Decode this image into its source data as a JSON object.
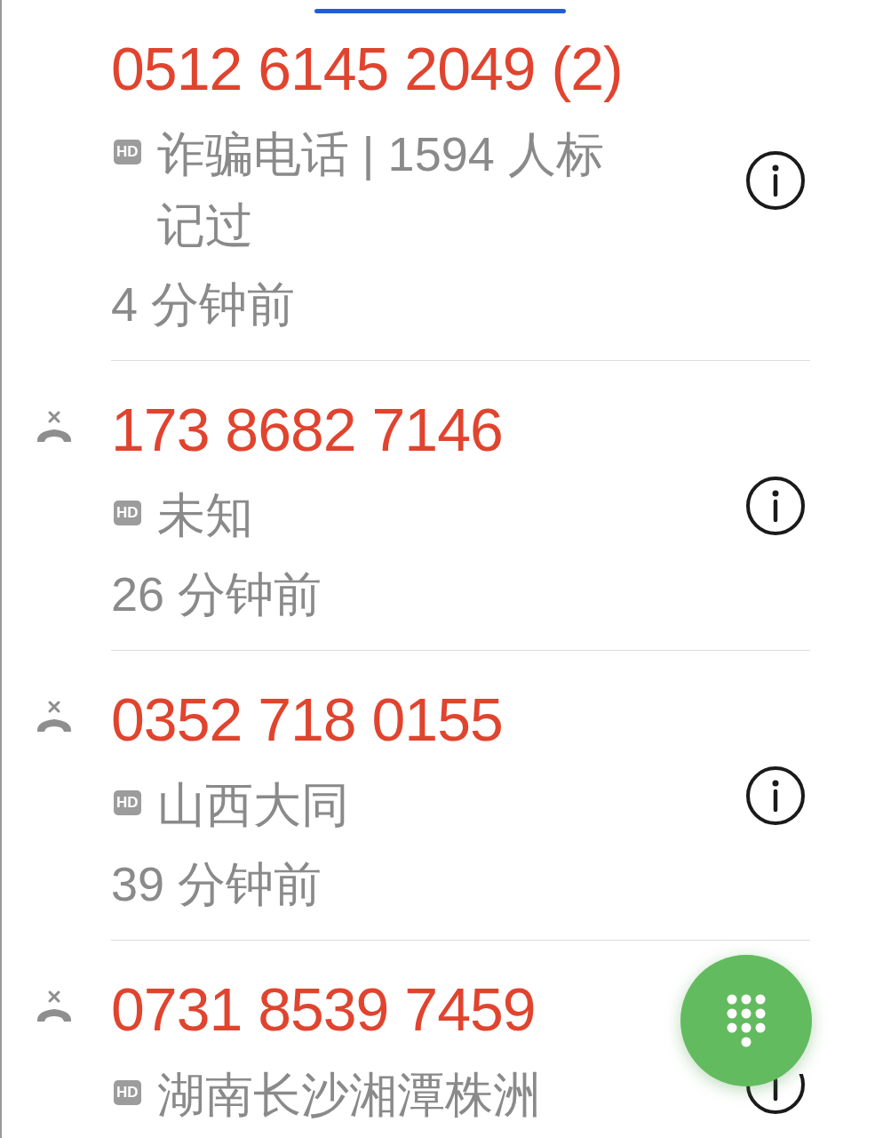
{
  "calls": [
    {
      "number": "0512 6145 2049 (2)",
      "missed": false,
      "badge": "HD",
      "label": "诈骗电话 | 1594 人标记过",
      "time": "4 分钟前"
    },
    {
      "number": "173 8682 7146",
      "missed": true,
      "badge": "HD",
      "label": "未知",
      "time": "26 分钟前"
    },
    {
      "number": "0352 718 0155",
      "missed": true,
      "badge": "HD",
      "label": "山西大同",
      "time": "39 分钟前"
    },
    {
      "number": "0731 8539 7459",
      "missed": true,
      "badge": "HD",
      "label": "湖南长沙湘潭株洲"
    }
  ]
}
